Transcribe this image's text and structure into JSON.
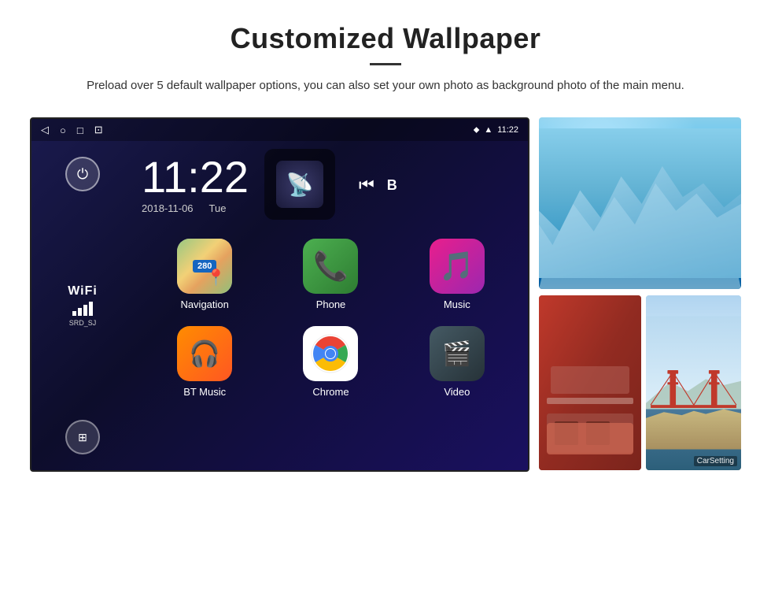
{
  "header": {
    "title": "Customized Wallpaper",
    "description": "Preload over 5 default wallpaper options, you can also set your own photo as background photo of the main menu."
  },
  "device": {
    "time": "11:22",
    "date": "2018-11-06",
    "day": "Tue",
    "network": "SRD_SJ",
    "wifi_label": "WiFi"
  },
  "apps": [
    {
      "name": "Navigation",
      "type": "navigation"
    },
    {
      "name": "Phone",
      "type": "phone"
    },
    {
      "name": "Music",
      "type": "music"
    },
    {
      "name": "BT Music",
      "type": "bt"
    },
    {
      "name": "Chrome",
      "type": "chrome"
    },
    {
      "name": "Video",
      "type": "video"
    }
  ],
  "nav_badge": "280",
  "carsetting_label": "CarSetting"
}
